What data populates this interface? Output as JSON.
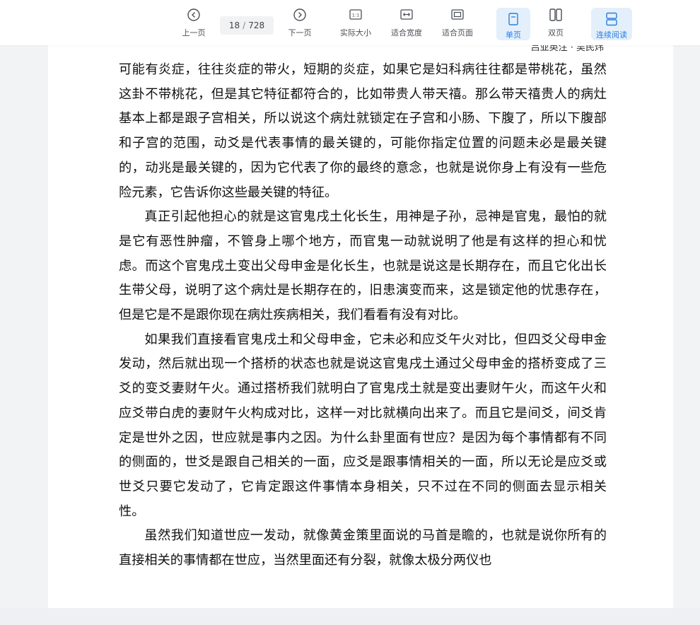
{
  "toolbar": {
    "prev_label": "上一页",
    "page_current": "18",
    "page_separator": "/",
    "page_total": "728",
    "next_label": "下一页",
    "actual_size_label": "实际大小",
    "fit_width_label": "适合宽度",
    "fit_page_label": "适合页面",
    "single_page_label": "单页",
    "double_page_label": "双页",
    "continuous_label": "连续阅读",
    "accent_color": "#2b7de0"
  },
  "document": {
    "header_fragment": "吕亚英注 · 吴民炜",
    "paragraphs": [
      {
        "indent": false,
        "text": "可能有炎症，往往炎症的带火，短期的炎症，如果它是妇科病往往都是带桃花，虽然这卦不带桃花，但是其它特征都符合的，比如带贵人带天禧。那么带天禧贵人的病灶基本上都是跟子宫相关，所以说这个病灶就锁定在子宫和小肠、下腹了，所以下腹部和子宫的范围，动爻是代表事情的最关键的，可能你指定位置的问题未必是最关键的，动兆是最关键的，因为它代表了你的最终的意念，也就是说你身上有没有一些危险元素，它告诉你这些最关键的特征。"
      },
      {
        "indent": true,
        "text": "真正引起他担心的就是这官鬼戌土化长生，用神是子孙，忌神是官鬼，最怕的就是它有恶性肿瘤，不管身上哪个地方，而官鬼一动就说明了他是有这样的担心和忧虑。而这个官鬼戌土变出父母申金是化长生，也就是说这是长期存在，而且它化出长生带父母，说明了这个病灶是长期存在的，旧患演变而来，这是锁定他的忧患存在，但是它是不是跟你现在病灶疾病相关，我们看看有没有对比。"
      },
      {
        "indent": true,
        "text": "如果我们直接看官鬼戌土和父母申金，它未必和应爻午火对比，但四爻父母申金发动，然后就出现一个搭桥的状态也就是说这官鬼戌土通过父母申金的搭桥变成了三爻的变爻妻财午火。通过搭桥我们就明白了官鬼戌土就是变出妻财午火，而这午火和应爻带白虎的妻财午火构成对比，这样一对比就横向出来了。而且它是间爻，间爻肯定是世外之因，世应就是事内之因。为什么卦里面有世应？是因为每个事情都有不同的侧面的，世爻是跟自己相关的一面，应爻是跟事情相关的一面，所以无论是应爻或世爻只要它发动了，它肯定跟这件事情本身相关，只不过在不同的侧面去显示相关性。"
      },
      {
        "indent": true,
        "text": "虽然我们知道世应一发动，就像黄金策里面说的马首是瞻的，也就是说你所有的直接相关的事情都在世应，当然里面还有分裂，就像太极分两仪也"
      }
    ]
  }
}
